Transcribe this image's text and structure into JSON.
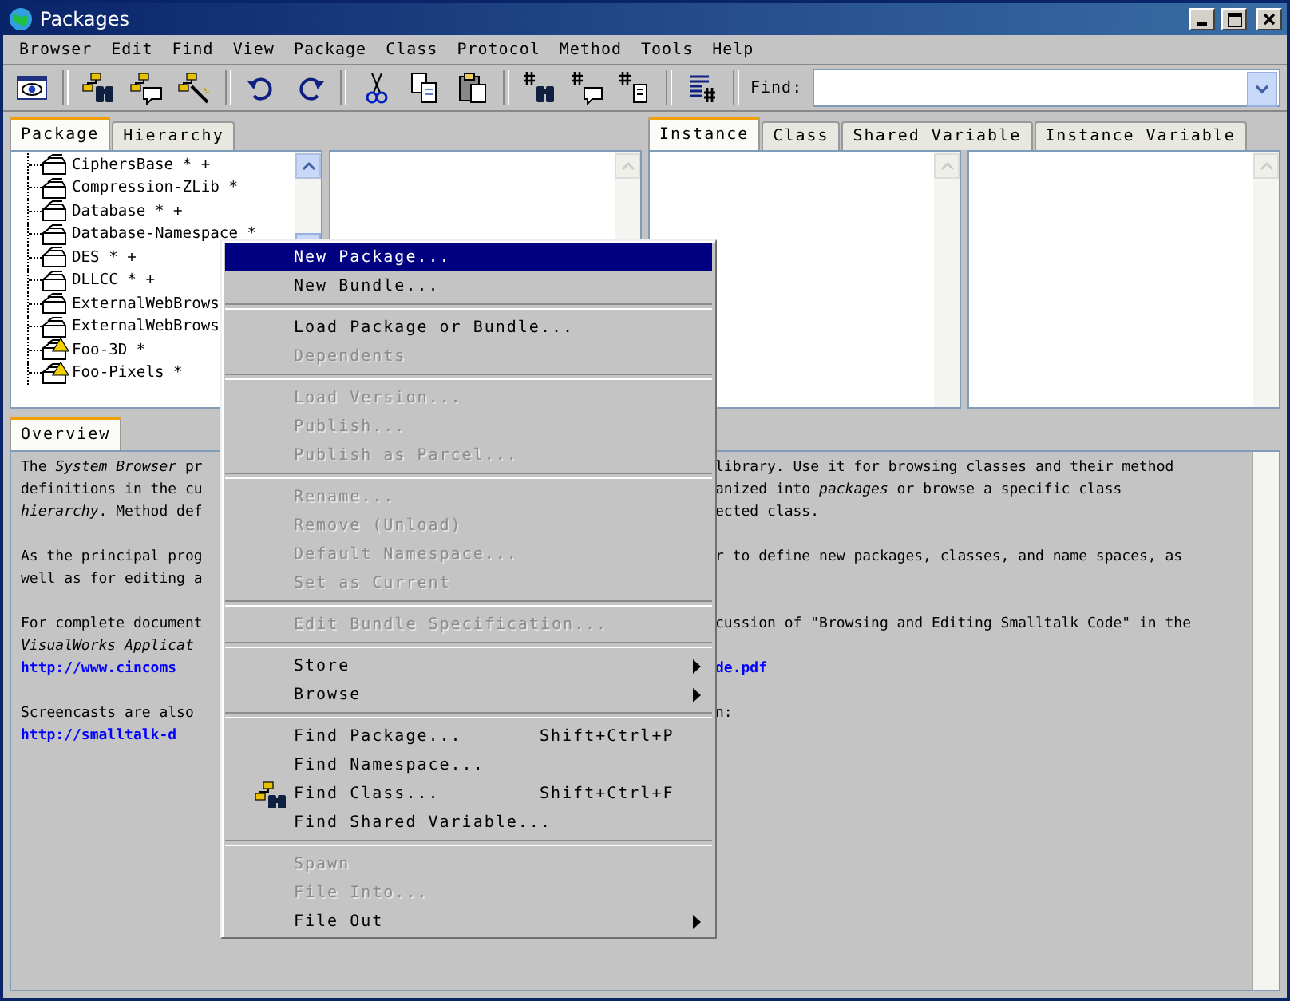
{
  "window": {
    "title": "Packages"
  },
  "menu_bar": [
    "Browser",
    "Edit",
    "Find",
    "View",
    "Package",
    "Class",
    "Protocol",
    "Method",
    "Tools",
    "Help"
  ],
  "find": {
    "label": "Find:"
  },
  "left_tabs": [
    {
      "label": "Package",
      "selected": true
    },
    {
      "label": "Hierarchy",
      "selected": false
    }
  ],
  "packages": [
    {
      "label": "CiphersBase * +",
      "warning": false
    },
    {
      "label": "Compression-ZLib *",
      "warning": false
    },
    {
      "label": "Database * +",
      "warning": false
    },
    {
      "label": "Database-Namespace *",
      "warning": false
    },
    {
      "label": "DES * +",
      "warning": false
    },
    {
      "label": "DLLCC * +",
      "warning": false
    },
    {
      "label": "ExternalWebBrows",
      "warning": false
    },
    {
      "label": "ExternalWebBrows",
      "warning": false
    },
    {
      "label": "Foo-3D *",
      "warning": true
    },
    {
      "label": "Foo-Pixels *",
      "warning": true
    }
  ],
  "right_tabs": [
    {
      "label": "Instance",
      "selected": true
    },
    {
      "label": "Class",
      "selected": false
    },
    {
      "label": "Shared Variable",
      "selected": false
    },
    {
      "label": "Instance Variable",
      "selected": false
    }
  ],
  "bottom_tabs": [
    {
      "label": "Overview",
      "selected": true
    }
  ],
  "overview": [
    {
      "lines": [
        {
          "left": {
            "text": "The *System Browser* pr",
            "kind": "text"
          },
          "right": {
            "text": "library. Use it for browsing classes and their method",
            "kind": "text"
          }
        },
        {
          "left": {
            "text": "definitions in the cu",
            "kind": "text"
          },
          "right": {
            "text": "anized into *packages* or browse a specific class",
            "kind": "text"
          }
        },
        {
          "left": {
            "text": "*hierarchy*. Method def",
            "kind": "text"
          },
          "right": {
            "text": "ected class.",
            "kind": "text"
          }
        }
      ]
    },
    {
      "lines": [
        {
          "left": {
            "text": "As the principal prog",
            "kind": "text"
          },
          "right": {
            "text": "r to define new packages, classes, and name spaces, as",
            "kind": "text"
          }
        },
        {
          "left": {
            "text": "well as for editing a",
            "kind": "text"
          }
        }
      ]
    },
    {
      "lines": [
        {
          "left": {
            "text": "For complete document",
            "kind": "text"
          },
          "right": {
            "text": "cussion of \"Browsing and Editing Smalltalk Code\" in the",
            "kind": "text"
          }
        },
        {
          "left": {
            "text": "*VisualWorks Applicat*",
            "kind": "text"
          }
        },
        {
          "left": {
            "text": "http://www.cincoms",
            "kind": "link"
          },
          "right": {
            "text": "de.pdf",
            "kind": "link"
          }
        }
      ]
    },
    {
      "lines": [
        {
          "left": {
            "text": "Screencasts are also",
            "kind": "text"
          },
          "right": {
            "text": "n:",
            "kind": "text"
          }
        },
        {
          "left": {
            "text": "http://smalltalk-d",
            "kind": "link"
          }
        }
      ]
    }
  ],
  "context_menu": [
    {
      "kind": "item",
      "label": "New Package...",
      "selected": true,
      "disabled": false
    },
    {
      "kind": "item",
      "label": "New Bundle...",
      "selected": false,
      "disabled": false
    },
    {
      "kind": "separator"
    },
    {
      "kind": "item",
      "label": "Load Package or Bundle...",
      "selected": false,
      "disabled": false
    },
    {
      "kind": "item",
      "label": "Dependents",
      "selected": false,
      "disabled": true
    },
    {
      "kind": "separator"
    },
    {
      "kind": "item",
      "label": "Load Version...",
      "selected": false,
      "disabled": true
    },
    {
      "kind": "item",
      "label": "Publish...",
      "selected": false,
      "disabled": true
    },
    {
      "kind": "item",
      "label": "Publish as Parcel...",
      "selected": false,
      "disabled": true
    },
    {
      "kind": "separator"
    },
    {
      "kind": "item",
      "label": "Rename...",
      "selected": false,
      "disabled": true
    },
    {
      "kind": "item",
      "label": "Remove (Unload)",
      "selected": false,
      "disabled": true
    },
    {
      "kind": "item",
      "label": "Default Namespace...",
      "selected": false,
      "disabled": true
    },
    {
      "kind": "item",
      "label": "Set as Current",
      "selected": false,
      "disabled": true
    },
    {
      "kind": "separator"
    },
    {
      "kind": "item",
      "label": "Edit Bundle Specification...",
      "selected": false,
      "disabled": true
    },
    {
      "kind": "separator"
    },
    {
      "kind": "submenu",
      "label": "Store",
      "selected": false,
      "disabled": false
    },
    {
      "kind": "submenu",
      "label": "Browse",
      "selected": false,
      "disabled": false
    },
    {
      "kind": "separator"
    },
    {
      "kind": "item",
      "label": "Find Package...",
      "shortcut": "Shift+Ctrl+P",
      "selected": false,
      "disabled": false
    },
    {
      "kind": "item",
      "label": "Find Namespace...",
      "selected": false,
      "disabled": false
    },
    {
      "kind": "item",
      "label": "Find Class...",
      "shortcut": "Shift+Ctrl+F",
      "icon": true,
      "selected": false,
      "disabled": false
    },
    {
      "kind": "item",
      "label": "Find Shared Variable...",
      "selected": false,
      "disabled": false
    },
    {
      "kind": "separator"
    },
    {
      "kind": "item",
      "label": "Spawn",
      "selected": false,
      "disabled": true
    },
    {
      "kind": "item",
      "label": "File Into...",
      "selected": false,
      "disabled": true
    },
    {
      "kind": "submenu",
      "label": "File Out",
      "selected": false,
      "disabled": false
    }
  ]
}
